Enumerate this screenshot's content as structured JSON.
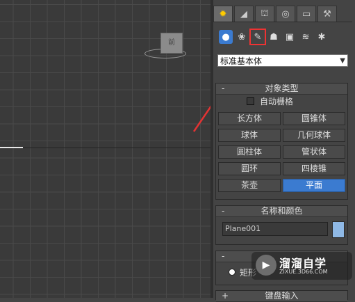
{
  "viewport": {
    "viewcube_label": "前"
  },
  "command_panel": {
    "tabs": [
      {
        "icon": "create-icon",
        "glyph": "✹"
      },
      {
        "icon": "modify-icon",
        "glyph": "◢"
      },
      {
        "icon": "hierarchy-icon",
        "glyph": "⛫"
      },
      {
        "icon": "motion-icon",
        "glyph": "◎"
      },
      {
        "icon": "display-icon",
        "glyph": "▭"
      },
      {
        "icon": "utilities-icon",
        "glyph": "⚒"
      }
    ],
    "subcategories": [
      {
        "icon": "geometry-icon",
        "glyph": "●"
      },
      {
        "icon": "shapes-icon",
        "glyph": "❀"
      },
      {
        "icon": "lights-icon",
        "glyph": "✎"
      },
      {
        "icon": "cameras-icon",
        "glyph": "☗"
      },
      {
        "icon": "helpers-icon",
        "glyph": "▣"
      },
      {
        "icon": "spacewarps-icon",
        "glyph": "≋"
      },
      {
        "icon": "systems-icon",
        "glyph": "✱"
      }
    ],
    "dropdown_value": "标准基本体",
    "object_type": {
      "sign": "-",
      "title": "对象类型",
      "autogrid_label": "自动栅格",
      "buttons": [
        "长方体",
        "圆锥体",
        "球体",
        "几何球体",
        "圆柱体",
        "管状体",
        "圆环",
        "四棱锥",
        "茶壶",
        "平面"
      ],
      "active_button": "平面"
    },
    "name_color": {
      "sign": "-",
      "title": "名称和颜色",
      "name_value": "Plane001",
      "color": "#8fb9e6"
    },
    "creation_method": {
      "sign": "-",
      "radio_label": "矩形"
    },
    "keyboard_entry": {
      "sign": "+",
      "title": "键盘输入"
    }
  },
  "annotation": {
    "highlight_color": "#e33333"
  },
  "watermark": {
    "title": "溜溜自学",
    "url": "ZIXUE.3D66.COM"
  }
}
